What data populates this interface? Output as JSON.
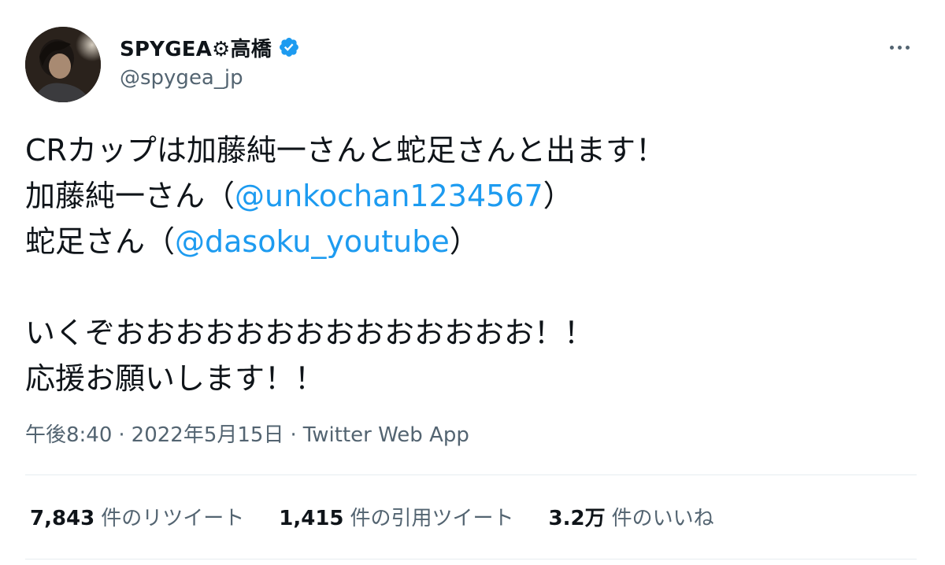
{
  "author": {
    "display_name": "SPYGEA⚙高橋",
    "handle": "@spygea_jp",
    "verified": true
  },
  "tweet": {
    "lines": [
      {
        "before": "CRカップは加藤純一さんと蛇足さんと出ます！"
      },
      {
        "before": "加藤純一さん（",
        "mention": "@unkochan1234567",
        "after": "）"
      },
      {
        "before": "蛇足さん（",
        "mention": "@dasoku_youtube",
        "after": "）"
      },
      {
        "before": ""
      },
      {
        "before": "いくぞおおおおおおおおおおおおおお！！"
      },
      {
        "before": "応援お願いします！！"
      }
    ],
    "time": "午後8:40",
    "date": "2022年5月15日",
    "separator": "·",
    "source": "Twitter Web App"
  },
  "stats": {
    "retweets": {
      "count": "7,843",
      "label": "件のリツイート"
    },
    "quotes": {
      "count": "1,415",
      "label": "件の引用ツイート"
    },
    "likes": {
      "count": "3.2万",
      "label": "件のいいね"
    }
  },
  "colors": {
    "accent": "#1d9bf0",
    "secondary_text": "#536471",
    "primary_text": "#0f1419"
  },
  "icons": {
    "verified": "verified-badge-icon",
    "more": "more-horizontal-icon"
  }
}
